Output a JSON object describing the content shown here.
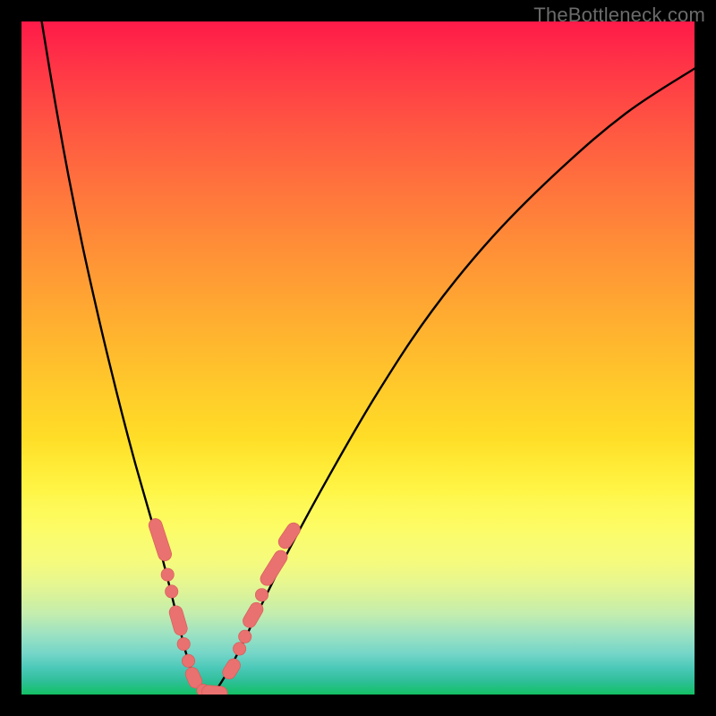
{
  "watermark": {
    "text": "TheBottleneck.com"
  },
  "colors": {
    "curve_stroke": "#000000",
    "marker_fill": "#e9716f",
    "marker_stroke": "#d65a58",
    "frame_bg": "#000000"
  },
  "chart_data": {
    "type": "line",
    "title": "",
    "xlabel": "",
    "ylabel": "",
    "xlim": [
      0,
      100
    ],
    "ylim": [
      0,
      100
    ],
    "grid": false,
    "legend": false,
    "series": [
      {
        "name": "bottleneck-curve",
        "x": [
          3,
          5,
          7,
          9,
          11,
          13,
          15,
          17,
          19,
          21,
          23,
          24.5,
          26,
          28,
          31,
          35,
          40,
          46,
          53,
          61,
          70,
          80,
          90,
          100
        ],
        "y": [
          100,
          88,
          77,
          67,
          58,
          49.5,
          41.5,
          34,
          27,
          20,
          12,
          6,
          2,
          0,
          4,
          12,
          22,
          33,
          45,
          57,
          68,
          78,
          86.5,
          93
        ]
      }
    ],
    "markers": [
      {
        "shape": "pill",
        "x": 20.6,
        "y": 23.0,
        "angle": 72,
        "len": 6.5
      },
      {
        "shape": "dot",
        "x": 21.7,
        "y": 17.8
      },
      {
        "shape": "dot",
        "x": 22.3,
        "y": 15.3
      },
      {
        "shape": "pill",
        "x": 23.3,
        "y": 11.0,
        "angle": 74,
        "len": 4.5
      },
      {
        "shape": "dot",
        "x": 24.1,
        "y": 7.5
      },
      {
        "shape": "dot",
        "x": 24.8,
        "y": 5.0
      },
      {
        "shape": "pill",
        "x": 25.6,
        "y": 2.5,
        "angle": 66,
        "len": 3.2
      },
      {
        "shape": "dot",
        "x": 27.0,
        "y": 0.6
      },
      {
        "shape": "pill",
        "x": 28.7,
        "y": 0.3,
        "angle": 5,
        "len": 3.8
      },
      {
        "shape": "pill",
        "x": 31.2,
        "y": 3.8,
        "angle": -58,
        "len": 3.2
      },
      {
        "shape": "dot",
        "x": 32.4,
        "y": 6.8
      },
      {
        "shape": "dot",
        "x": 33.2,
        "y": 8.6
      },
      {
        "shape": "pill",
        "x": 34.4,
        "y": 11.8,
        "angle": -60,
        "len": 4.0
      },
      {
        "shape": "dot",
        "x": 35.7,
        "y": 14.8
      },
      {
        "shape": "pill",
        "x": 37.5,
        "y": 18.8,
        "angle": -58,
        "len": 5.8
      },
      {
        "shape": "pill",
        "x": 39.8,
        "y": 23.6,
        "angle": -56,
        "len": 4.2
      }
    ]
  }
}
